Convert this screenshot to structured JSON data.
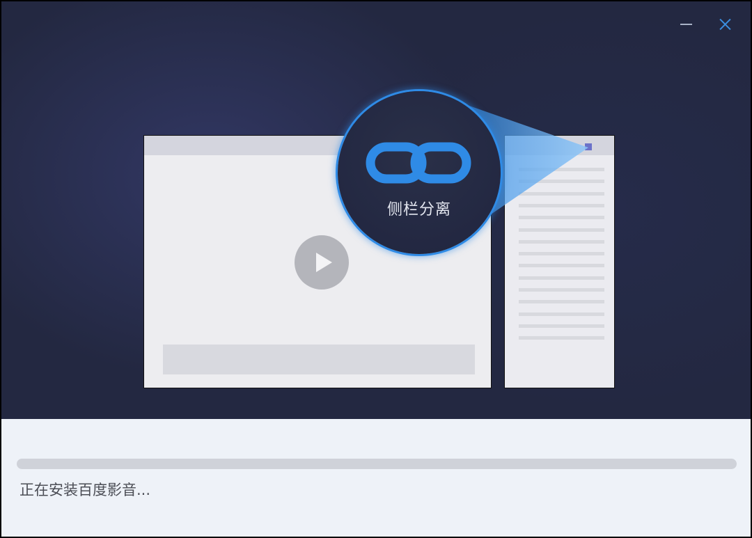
{
  "window": {
    "controls": {
      "minimize_icon": "minimize-icon",
      "close_icon": "close-icon"
    }
  },
  "feature": {
    "icon": "link-icon",
    "label": "侧栏分离"
  },
  "illustration": {
    "play_icon": "play-icon"
  },
  "install": {
    "status_text": "正在安装百度影音...",
    "progress": 0
  },
  "colors": {
    "accent": "#2f8be6",
    "hero_bg": "#232841",
    "panel_bg": "#eef2f8",
    "detach_marker": "#6b72c9"
  }
}
